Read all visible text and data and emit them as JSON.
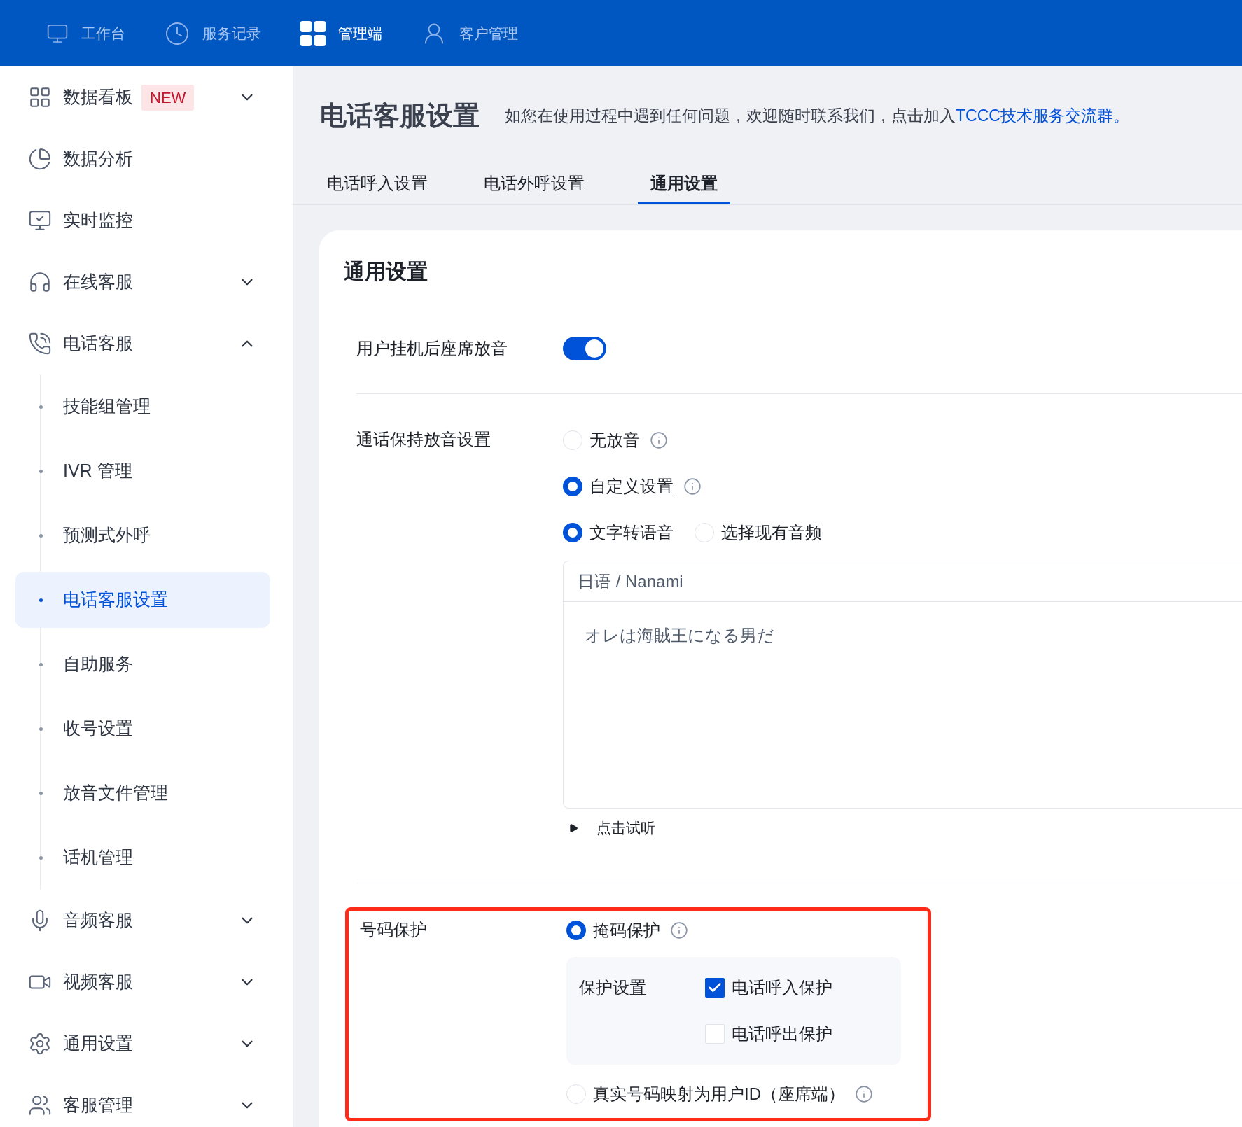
{
  "top_nav": [
    {
      "label": "工作台",
      "selected": false
    },
    {
      "label": "服务记录",
      "selected": false
    },
    {
      "label": "管理端",
      "selected": true
    },
    {
      "label": "客户管理",
      "selected": false
    }
  ],
  "sidebar": {
    "items": [
      {
        "label": "数据看板",
        "badge": "NEW",
        "expanded": false
      },
      {
        "label": "数据分析"
      },
      {
        "label": "实时监控"
      },
      {
        "label": "在线客服",
        "expanded": false
      },
      {
        "label": "电话客服",
        "expanded": true,
        "children": [
          {
            "label": "技能组管理",
            "selected": false
          },
          {
            "label": "IVR 管理",
            "selected": false
          },
          {
            "label": "预测式外呼",
            "selected": false
          },
          {
            "label": "电话客服设置",
            "selected": true
          },
          {
            "label": "自助服务",
            "selected": false
          },
          {
            "label": "收号设置",
            "selected": false
          },
          {
            "label": "放音文件管理",
            "selected": false
          },
          {
            "label": "话机管理",
            "selected": false
          }
        ]
      },
      {
        "label": "音频客服",
        "expanded": false
      },
      {
        "label": "视频客服",
        "expanded": false
      },
      {
        "label": "通用设置",
        "expanded": false
      },
      {
        "label": "客服管理",
        "expanded": false
      }
    ]
  },
  "page": {
    "title": "电话客服设置",
    "intro": "如您在使用过程中遇到任何问题，欢迎随时联系我们，点击加入",
    "intro_link": "TCCC技术服务交流群。"
  },
  "tabs": [
    {
      "label": "电话呼入设置",
      "selected": false
    },
    {
      "label": "电话外呼设置",
      "selected": false
    },
    {
      "label": "通用设置",
      "selected": true
    }
  ],
  "card": {
    "title": "通用设置",
    "settings": [
      {
        "kind": "toggle",
        "label": "用户挂机后座席放音",
        "on": true
      },
      {
        "kind": "hold_audio",
        "label": "通话保持放音设置",
        "options": [
          {
            "label": "无放音",
            "selected": false,
            "info": true
          },
          {
            "label": "自定义设置",
            "selected": true,
            "info": true
          }
        ],
        "sources": [
          {
            "label": "文字转语音",
            "selected": true
          },
          {
            "label": "选择现有音频",
            "selected": false
          }
        ],
        "voice": "日语 / Nanami",
        "text": "オレは海賊王になる男だ",
        "preview": "点击试听"
      },
      {
        "kind": "protection",
        "label": "号码保护",
        "highlighted": true,
        "options": [
          {
            "label": "掩码保护",
            "selected": true,
            "info": true
          },
          {
            "label": "真实号码映射为用户ID（座席端）",
            "selected": false,
            "info": true
          }
        ],
        "protection_settings": {
          "label": "保护设置",
          "checks": [
            {
              "label": "电话呼入保护",
              "checked": true
            },
            {
              "label": "电话呼出保护",
              "checked": false
            }
          ]
        }
      }
    ]
  }
}
